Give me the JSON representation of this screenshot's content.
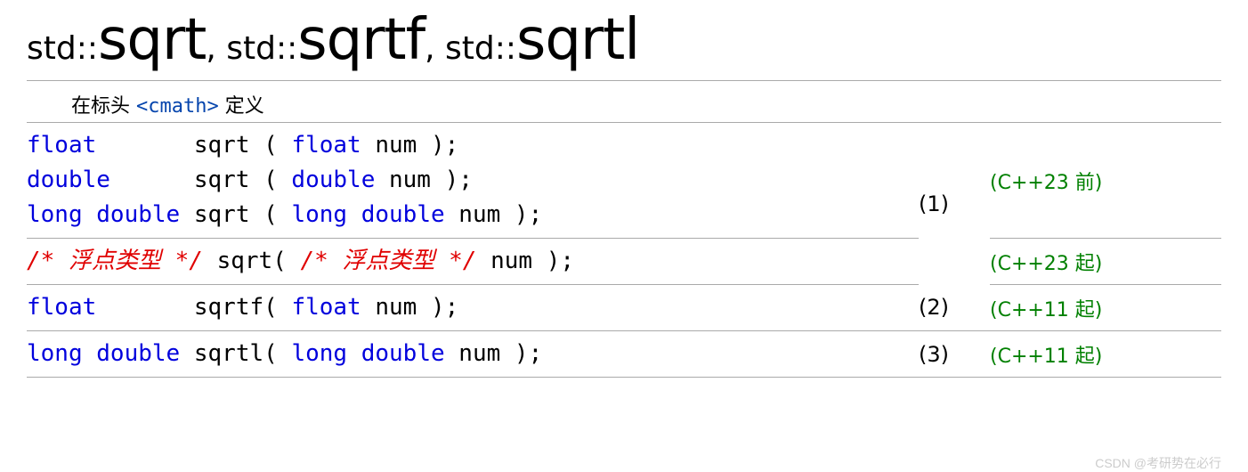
{
  "title": {
    "p1": "std::",
    "p1big": "sqrt",
    "sep1": ", ",
    "p2": "std::",
    "p2big": "sqrtf",
    "sep2": ", ",
    "p3": "std::",
    "p3big": "sqrtl"
  },
  "header": {
    "prefix": "在标头 ",
    "link": "<cmath>",
    "suffix": " 定义"
  },
  "rows": [
    {
      "num": "(1)",
      "subrows": [
        {
          "sig": [
            {
              "t": "kw",
              "v": "float"
            },
            {
              "t": "id",
              "v": "       sqrt "
            },
            {
              "t": "id",
              "v": "("
            },
            {
              "t": "id",
              "v": " "
            },
            {
              "t": "kw",
              "v": "float"
            },
            {
              "t": "id",
              "v": " num "
            },
            {
              "t": "id",
              "v": ")"
            },
            {
              "t": "id",
              "v": ";"
            },
            {
              "t": "nl",
              "v": "\n"
            },
            {
              "t": "kw",
              "v": "double"
            },
            {
              "t": "id",
              "v": "      sqrt "
            },
            {
              "t": "id",
              "v": "("
            },
            {
              "t": "id",
              "v": " "
            },
            {
              "t": "kw",
              "v": "double"
            },
            {
              "t": "id",
              "v": " num "
            },
            {
              "t": "id",
              "v": ")"
            },
            {
              "t": "id",
              "v": ";"
            },
            {
              "t": "nl",
              "v": "\n"
            },
            {
              "t": "kw",
              "v": "long"
            },
            {
              "t": "id",
              "v": " "
            },
            {
              "t": "kw",
              "v": "double"
            },
            {
              "t": "id",
              "v": " sqrt "
            },
            {
              "t": "id",
              "v": "("
            },
            {
              "t": "id",
              "v": " "
            },
            {
              "t": "kw",
              "v": "long"
            },
            {
              "t": "id",
              "v": " "
            },
            {
              "t": "kw",
              "v": "double"
            },
            {
              "t": "id",
              "v": " num "
            },
            {
              "t": "id",
              "v": ")"
            },
            {
              "t": "id",
              "v": ";"
            }
          ],
          "ver": "(C++23 前)"
        },
        {
          "sig": [
            {
              "t": "co",
              "v": "/* 浮点类型 */"
            },
            {
              "t": "id",
              "v": " sqrt"
            },
            {
              "t": "id",
              "v": "("
            },
            {
              "t": "id",
              "v": " "
            },
            {
              "t": "co",
              "v": "/* 浮点类型 */"
            },
            {
              "t": "id",
              "v": " num "
            },
            {
              "t": "id",
              "v": ")"
            },
            {
              "t": "id",
              "v": ";"
            }
          ],
          "ver": "(C++23 起)"
        }
      ]
    },
    {
      "num": "(2)",
      "sig": [
        {
          "t": "kw",
          "v": "float"
        },
        {
          "t": "id",
          "v": "       sqrtf"
        },
        {
          "t": "id",
          "v": "("
        },
        {
          "t": "id",
          "v": " "
        },
        {
          "t": "kw",
          "v": "float"
        },
        {
          "t": "id",
          "v": " num "
        },
        {
          "t": "id",
          "v": ")"
        },
        {
          "t": "id",
          "v": ";"
        }
      ],
      "ver": "(C++11 起)"
    },
    {
      "num": "(3)",
      "sig": [
        {
          "t": "kw",
          "v": "long"
        },
        {
          "t": "id",
          "v": " "
        },
        {
          "t": "kw",
          "v": "double"
        },
        {
          "t": "id",
          "v": " sqrtl"
        },
        {
          "t": "id",
          "v": "("
        },
        {
          "t": "id",
          "v": " "
        },
        {
          "t": "kw",
          "v": "long"
        },
        {
          "t": "id",
          "v": " "
        },
        {
          "t": "kw",
          "v": "double"
        },
        {
          "t": "id",
          "v": " num "
        },
        {
          "t": "id",
          "v": ")"
        },
        {
          "t": "id",
          "v": ";"
        }
      ],
      "ver": "(C++11 起)"
    }
  ],
  "watermark": "CSDN @考研势在必行"
}
